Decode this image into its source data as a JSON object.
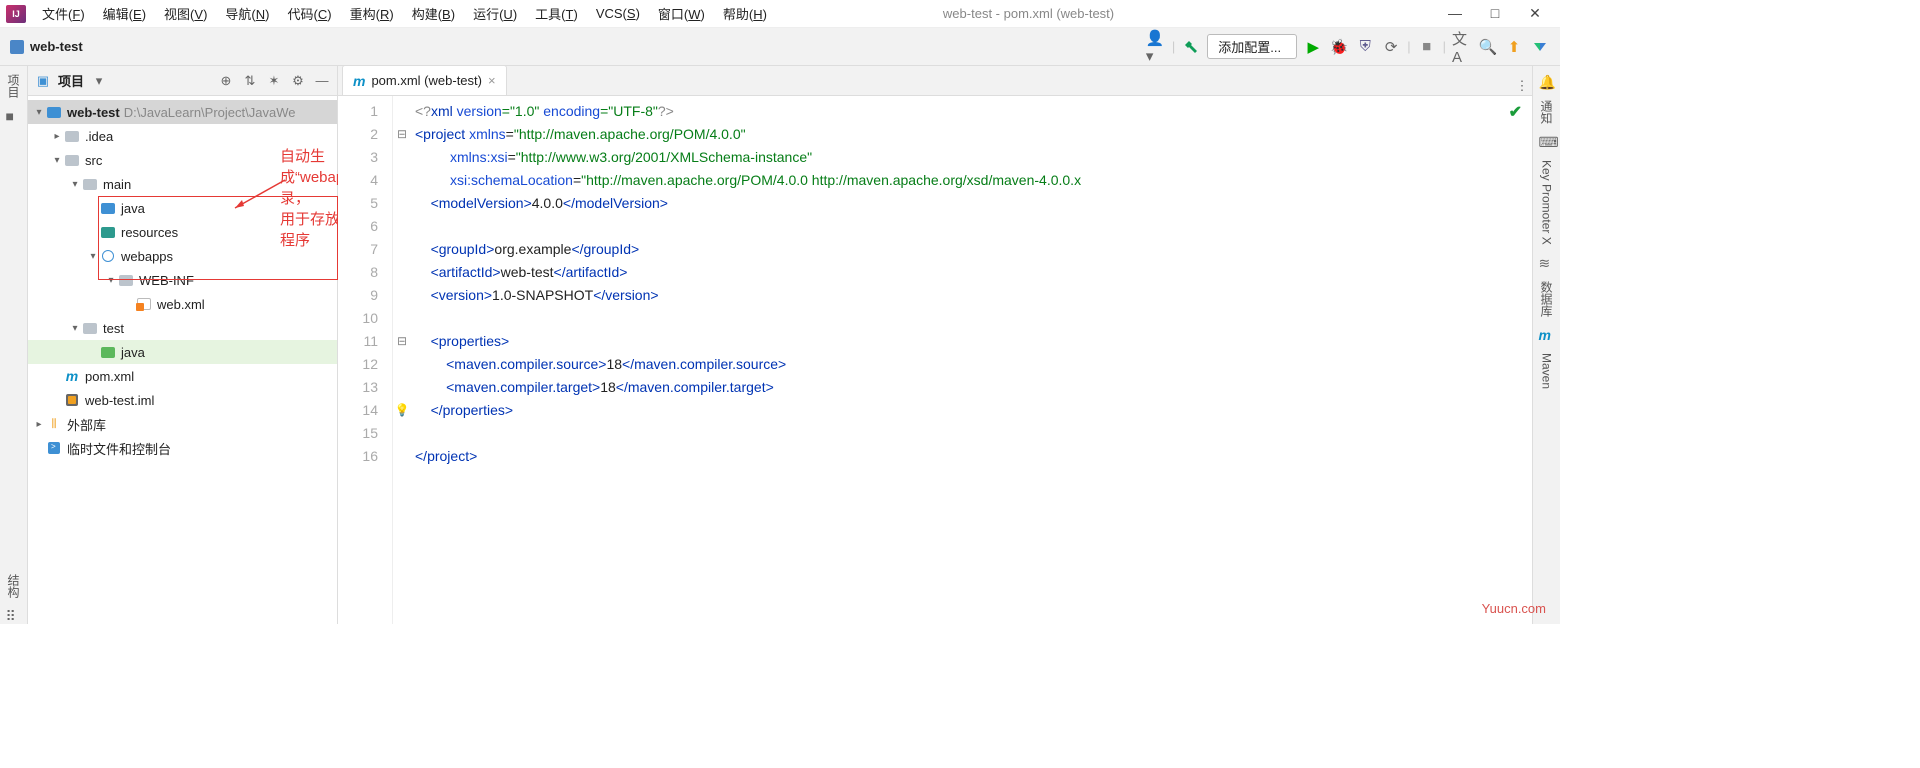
{
  "menu": {
    "file": "文件",
    "edit": "编辑",
    "view": "视图",
    "navigate": "导航",
    "code": "代码",
    "refactor": "重构",
    "build": "构建",
    "run": "运行",
    "tools": "工具",
    "vcs": "VCS",
    "window": "窗口",
    "help": "帮助",
    "k": {
      "file": "F",
      "edit": "E",
      "view": "V",
      "navigate": "N",
      "code": "C",
      "refactor": "R",
      "build": "B",
      "run": "U",
      "tools": "T",
      "vcs": "S",
      "window": "W",
      "help": "H"
    }
  },
  "window_title": "web-test - pom.xml (web-test)",
  "breadcrumb": {
    "project": "web-test"
  },
  "toolbar": {
    "run_config": "添加配置..."
  },
  "left_strip": {
    "project": "项目",
    "structure": "结构"
  },
  "right_strip": {
    "notify": "通知",
    "key": "Key Promoter X",
    "db": "数据库",
    "maven": "Maven"
  },
  "panel": {
    "title": "项目"
  },
  "tree": {
    "root": {
      "name": "web-test",
      "loc": "D:\\JavaLearn\\Project\\JavaWe"
    },
    "idea": ".idea",
    "src": "src",
    "main": "main",
    "java": "java",
    "resources": "resources",
    "webapps": "webapps",
    "webinf": "WEB-INF",
    "webxml": "web.xml",
    "test": "test",
    "java2": "java",
    "pom": "pom.xml",
    "iml": "web-test.iml",
    "libs": "外部库",
    "scratch": "临时文件和控制台"
  },
  "annotation": {
    "line1": "自动生成“webapps”目录，",
    "line2": "用于存放web程序"
  },
  "tab": {
    "label": "pom.xml (web-test)"
  },
  "watermark": "Yuucn.com",
  "code": {
    "l1": "<?xml version=\"1.0\" encoding=\"UTF-8\"?>",
    "l2a": "<project ",
    "l2b": "xmlns",
    "l2c": "=\"http://maven.apache.org/POM/4.0.0\"",
    "l3a": "xmlns:xsi",
    "l3b": "=\"http://www.w3.org/2001/XMLSchema-instance\"",
    "l4a": "xsi:schemaLocation",
    "l4b": "=\"http://maven.apache.org/POM/4.0.0 http://maven.apache.org/xsd/maven-4.0.0.x",
    "l5": "    <modelVersion>4.0.0</modelVersion>",
    "l7": "    <groupId>org.example</groupId>",
    "l8": "    <artifactId>web-test</artifactId>",
    "l9": "    <version>1.0-SNAPSHOT</version>",
    "l11": "    <properties>",
    "l12": "        <maven.compiler.source>18</maven.compiler.source>",
    "l13": "        <maven.compiler.target>18</maven.compiler.target>",
    "l14": "    </properties>",
    "l16": "</project>"
  },
  "gutter": [
    "1",
    "2",
    "3",
    "4",
    "5",
    "6",
    "7",
    "8",
    "9",
    "10",
    "11",
    "12",
    "13",
    "14",
    "15",
    "16"
  ]
}
